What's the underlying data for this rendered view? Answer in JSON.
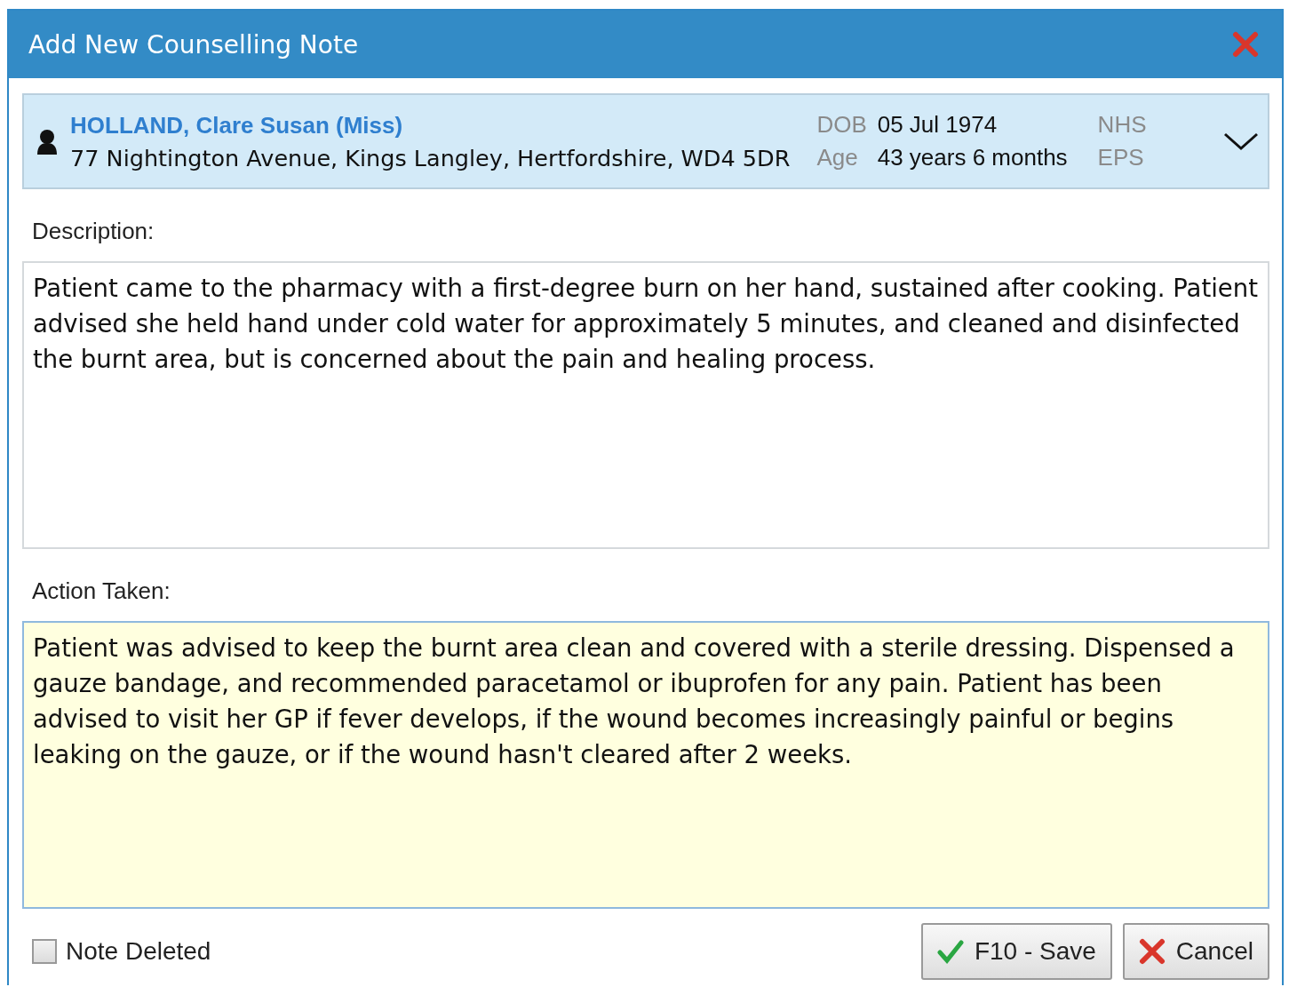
{
  "window": {
    "title": "Add New Counselling Note"
  },
  "patient": {
    "name": "HOLLAND, Clare Susan (Miss)",
    "address": "77 Nightington Avenue, Kings Langley, Hertfordshire, WD4 5DR",
    "dob_label": "DOB",
    "dob": "05 Jul 1974",
    "age_label": "Age",
    "age": "43 years 6 months",
    "nhs_label": "NHS",
    "eps_label": "EPS"
  },
  "description": {
    "label": "Description:",
    "value": "Patient came to the pharmacy with a first-degree burn on her hand, sustained after cooking. Patient advised she held hand under cold water for approximately 5 minutes, and cleaned and disinfected the burnt area, but is concerned about the pain and healing process."
  },
  "action_taken": {
    "label": "Action Taken:",
    "value": "Patient was advised to keep the burnt area clean and covered with a sterile dressing. Dispensed a gauze bandage, and recommended paracetamol or ibuprofen for any pain. Patient has been advised to visit her GP if fever develops, if the wound becomes increasingly painful or begins leaking on the gauze, or if the wound hasn't cleared after 2 weeks."
  },
  "note_deleted": {
    "label": "Note Deleted",
    "checked": false
  },
  "buttons": [
    {
      "kind": "save",
      "label": "F10 - Save"
    },
    {
      "kind": "cancel",
      "label": "Cancel"
    }
  ]
}
